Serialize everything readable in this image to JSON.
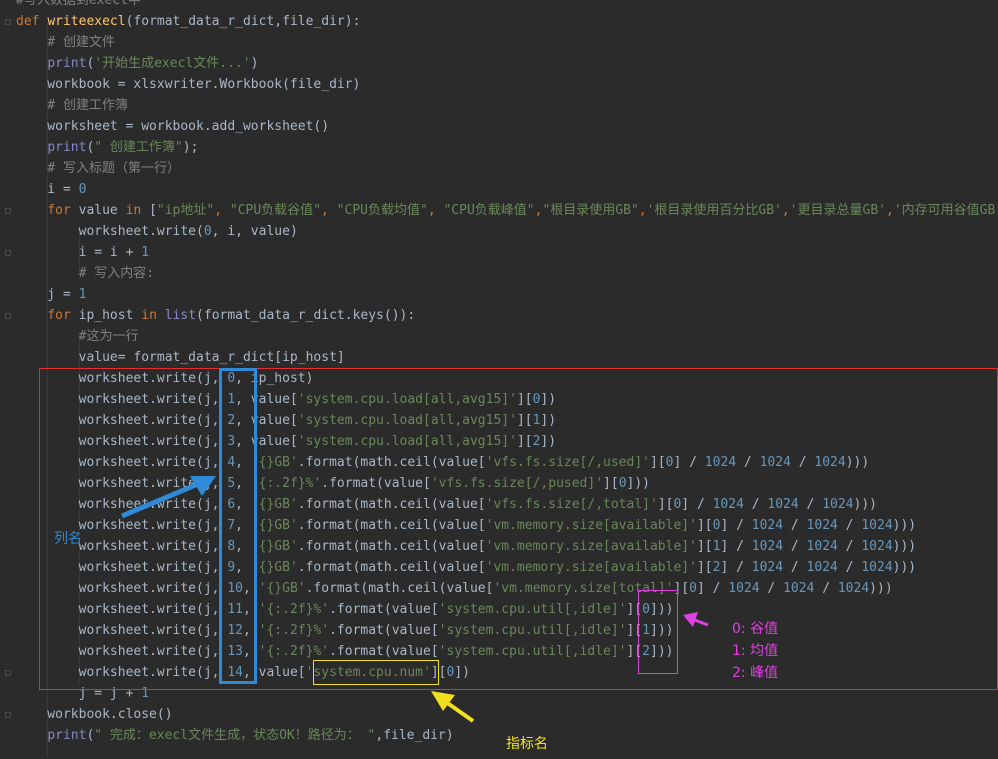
{
  "editor": {
    "language": "python",
    "lines": [
      {
        "tokens": [
          {
            "t": "#写入数据到execl中",
            "c": "cmt"
          }
        ]
      },
      {
        "tokens": [
          {
            "t": "def ",
            "c": "kw"
          },
          {
            "t": "writeexecl",
            "c": "fn"
          },
          {
            "t": "(format_data_r_dict,file_dir):",
            "c": "p"
          }
        ]
      },
      {
        "tokens": [
          {
            "t": "    # 创建文件",
            "c": "cmt"
          }
        ]
      },
      {
        "tokens": [
          {
            "t": "    ",
            "c": "p"
          },
          {
            "t": "print",
            "c": "bi"
          },
          {
            "t": "(",
            "c": "p"
          },
          {
            "t": "'开始生成execl文件...'",
            "c": "str"
          },
          {
            "t": ")",
            "c": "p"
          }
        ]
      },
      {
        "tokens": [
          {
            "t": "    workbook = xlsxwriter.Workbook(file_dir)",
            "c": "p"
          }
        ]
      },
      {
        "tokens": [
          {
            "t": "    # 创建工作簿",
            "c": "cmt"
          }
        ]
      },
      {
        "tokens": [
          {
            "t": "    worksheet = workbook.add_worksheet()",
            "c": "p"
          }
        ]
      },
      {
        "tokens": [
          {
            "t": "    ",
            "c": "p"
          },
          {
            "t": "print",
            "c": "bi"
          },
          {
            "t": "(",
            "c": "p"
          },
          {
            "t": "\" 创建工作簿\"",
            "c": "str"
          },
          {
            "t": ");",
            "c": "p"
          }
        ]
      },
      {
        "tokens": [
          {
            "t": "    # 写入标题（第一行）",
            "c": "cmt"
          }
        ]
      },
      {
        "tokens": [
          {
            "t": "    i = ",
            "c": "p"
          },
          {
            "t": "0",
            "c": "num"
          }
        ]
      },
      {
        "tokens": [
          {
            "t": "    ",
            "c": "p"
          },
          {
            "t": "for ",
            "c": "kw"
          },
          {
            "t": "value ",
            "c": "p"
          },
          {
            "t": "in ",
            "c": "kw"
          },
          {
            "t": "[",
            "c": "p"
          },
          {
            "t": "\"ip地址\"",
            "c": "str"
          },
          {
            "t": ", ",
            "c": "kw"
          },
          {
            "t": "\"CPU负载谷值\"",
            "c": "str"
          },
          {
            "t": ", ",
            "c": "kw"
          },
          {
            "t": "\"CPU负载均值\"",
            "c": "str"
          },
          {
            "t": ", ",
            "c": "kw"
          },
          {
            "t": "\"CPU负载峰值\"",
            "c": "str"
          },
          {
            "t": ",",
            "c": "kw"
          },
          {
            "t": "\"根目录使用GB\"",
            "c": "str"
          },
          {
            "t": ",",
            "c": "kw"
          },
          {
            "t": "'根目录使用百分比GB'",
            "c": "str"
          },
          {
            "t": ",",
            "c": "kw"
          },
          {
            "t": "'更目录总量GB'",
            "c": "str"
          },
          {
            "t": ",",
            "c": "kw"
          },
          {
            "t": "'内存可用谷值GB'",
            "c": "str"
          }
        ]
      },
      {
        "tokens": [
          {
            "t": "        worksheet.write(",
            "c": "p"
          },
          {
            "t": "0",
            "c": "num"
          },
          {
            "t": ", i, value)",
            "c": "p"
          }
        ]
      },
      {
        "tokens": [
          {
            "t": "        i = i + ",
            "c": "p"
          },
          {
            "t": "1",
            "c": "num"
          }
        ]
      },
      {
        "tokens": [
          {
            "t": "        # 写入内容:",
            "c": "cmt"
          }
        ]
      },
      {
        "tokens": [
          {
            "t": "    j = ",
            "c": "p"
          },
          {
            "t": "1",
            "c": "num"
          }
        ]
      },
      {
        "tokens": [
          {
            "t": "    ",
            "c": "p"
          },
          {
            "t": "for ",
            "c": "kw"
          },
          {
            "t": "ip_host ",
            "c": "p"
          },
          {
            "t": "in ",
            "c": "kw"
          },
          {
            "t": "list",
            "c": "bi"
          },
          {
            "t": "(format_data_r_dict.keys()):",
            "c": "p"
          }
        ]
      },
      {
        "tokens": [
          {
            "t": "        #这为一行",
            "c": "cmt"
          }
        ]
      },
      {
        "tokens": [
          {
            "t": "        value= format_data_r_dict[ip_host]",
            "c": "p"
          }
        ]
      },
      {
        "tokens": [
          {
            "t": "        worksheet.write(j, ",
            "c": "p"
          },
          {
            "t": "0",
            "c": "num"
          },
          {
            "t": ", ip_host)",
            "c": "p"
          }
        ]
      },
      {
        "tokens": [
          {
            "t": "        worksheet.write(j, ",
            "c": "p"
          },
          {
            "t": "1",
            "c": "num"
          },
          {
            "t": ", value[",
            "c": "p"
          },
          {
            "t": "'system.cpu.load[all,avg15]'",
            "c": "str"
          },
          {
            "t": "][",
            "c": "p"
          },
          {
            "t": "0",
            "c": "num"
          },
          {
            "t": "])",
            "c": "p"
          }
        ]
      },
      {
        "tokens": [
          {
            "t": "        worksheet.write(j, ",
            "c": "p"
          },
          {
            "t": "2",
            "c": "num"
          },
          {
            "t": ", value[",
            "c": "p"
          },
          {
            "t": "'system.cpu.load[all,avg15]'",
            "c": "str"
          },
          {
            "t": "][",
            "c": "p"
          },
          {
            "t": "1",
            "c": "num"
          },
          {
            "t": "])",
            "c": "p"
          }
        ]
      },
      {
        "tokens": [
          {
            "t": "        worksheet.write(j, ",
            "c": "p"
          },
          {
            "t": "3",
            "c": "num"
          },
          {
            "t": ", value[",
            "c": "p"
          },
          {
            "t": "'system.cpu.load[all,avg15]'",
            "c": "str"
          },
          {
            "t": "][",
            "c": "p"
          },
          {
            "t": "2",
            "c": "num"
          },
          {
            "t": "])",
            "c": "p"
          }
        ]
      },
      {
        "tokens": [
          {
            "t": "        worksheet.write(j, ",
            "c": "p"
          },
          {
            "t": "4",
            "c": "num"
          },
          {
            "t": ", ",
            "c": "p"
          },
          {
            "t": "'{}GB'",
            "c": "str"
          },
          {
            "t": ".format(math.ceil(value[",
            "c": "p"
          },
          {
            "t": "'vfs.fs.size[/,used]'",
            "c": "str"
          },
          {
            "t": "][",
            "c": "p"
          },
          {
            "t": "0",
            "c": "num"
          },
          {
            "t": "] / ",
            "c": "p"
          },
          {
            "t": "1024",
            "c": "num"
          },
          {
            "t": " / ",
            "c": "p"
          },
          {
            "t": "1024",
            "c": "num"
          },
          {
            "t": " / ",
            "c": "p"
          },
          {
            "t": "1024",
            "c": "num"
          },
          {
            "t": ")))",
            "c": "p"
          }
        ]
      },
      {
        "tokens": [
          {
            "t": "        worksheet.write(j, ",
            "c": "p"
          },
          {
            "t": "5",
            "c": "num"
          },
          {
            "t": ", ",
            "c": "p"
          },
          {
            "t": "'{:.2f}%'",
            "c": "str"
          },
          {
            "t": ".format(value[",
            "c": "p"
          },
          {
            "t": "'vfs.fs.size[/,pused]'",
            "c": "str"
          },
          {
            "t": "][",
            "c": "p"
          },
          {
            "t": "0",
            "c": "num"
          },
          {
            "t": "]))",
            "c": "p"
          }
        ]
      },
      {
        "tokens": [
          {
            "t": "        worksheet.write(j, ",
            "c": "p"
          },
          {
            "t": "6",
            "c": "num"
          },
          {
            "t": ", ",
            "c": "p"
          },
          {
            "t": "'{}GB'",
            "c": "str"
          },
          {
            "t": ".format(math.ceil(value[",
            "c": "p"
          },
          {
            "t": "'vfs.fs.size[/,total]'",
            "c": "str"
          },
          {
            "t": "][",
            "c": "p"
          },
          {
            "t": "0",
            "c": "num"
          },
          {
            "t": "] / ",
            "c": "p"
          },
          {
            "t": "1024",
            "c": "num"
          },
          {
            "t": " / ",
            "c": "p"
          },
          {
            "t": "1024",
            "c": "num"
          },
          {
            "t": " / ",
            "c": "p"
          },
          {
            "t": "1024",
            "c": "num"
          },
          {
            "t": ")))",
            "c": "p"
          }
        ]
      },
      {
        "tokens": [
          {
            "t": "        worksheet.write(j, ",
            "c": "p"
          },
          {
            "t": "7",
            "c": "num"
          },
          {
            "t": ", ",
            "c": "p"
          },
          {
            "t": "'{}GB'",
            "c": "str"
          },
          {
            "t": ".format(math.ceil(value[",
            "c": "p"
          },
          {
            "t": "'vm.memory.size[available]'",
            "c": "str"
          },
          {
            "t": "][",
            "c": "p"
          },
          {
            "t": "0",
            "c": "num"
          },
          {
            "t": "] / ",
            "c": "p"
          },
          {
            "t": "1024",
            "c": "num"
          },
          {
            "t": " / ",
            "c": "p"
          },
          {
            "t": "1024",
            "c": "num"
          },
          {
            "t": " / ",
            "c": "p"
          },
          {
            "t": "1024",
            "c": "num"
          },
          {
            "t": ")))",
            "c": "p"
          }
        ]
      },
      {
        "tokens": [
          {
            "t": "        worksheet.write(j, ",
            "c": "p"
          },
          {
            "t": "8",
            "c": "num"
          },
          {
            "t": ", ",
            "c": "p"
          },
          {
            "t": "'{}GB'",
            "c": "str"
          },
          {
            "t": ".format(math.ceil(value[",
            "c": "p"
          },
          {
            "t": "'vm.memory.size[available]'",
            "c": "str"
          },
          {
            "t": "][",
            "c": "p"
          },
          {
            "t": "1",
            "c": "num"
          },
          {
            "t": "] / ",
            "c": "p"
          },
          {
            "t": "1024",
            "c": "num"
          },
          {
            "t": " / ",
            "c": "p"
          },
          {
            "t": "1024",
            "c": "num"
          },
          {
            "t": " / ",
            "c": "p"
          },
          {
            "t": "1024",
            "c": "num"
          },
          {
            "t": ")))",
            "c": "p"
          }
        ]
      },
      {
        "tokens": [
          {
            "t": "        worksheet.write(j, ",
            "c": "p"
          },
          {
            "t": "9",
            "c": "num"
          },
          {
            "t": ", ",
            "c": "p"
          },
          {
            "t": "'{}GB'",
            "c": "str"
          },
          {
            "t": ".format(math.ceil(value[",
            "c": "p"
          },
          {
            "t": "'vm.memory.size[available]'",
            "c": "str"
          },
          {
            "t": "][",
            "c": "p"
          },
          {
            "t": "2",
            "c": "num"
          },
          {
            "t": "] / ",
            "c": "p"
          },
          {
            "t": "1024",
            "c": "num"
          },
          {
            "t": " / ",
            "c": "p"
          },
          {
            "t": "1024",
            "c": "num"
          },
          {
            "t": " / ",
            "c": "p"
          },
          {
            "t": "1024",
            "c": "num"
          },
          {
            "t": ")))",
            "c": "p"
          }
        ]
      },
      {
        "tokens": [
          {
            "t": "        worksheet.write(j, ",
            "c": "p"
          },
          {
            "t": "10",
            "c": "num"
          },
          {
            "t": ", ",
            "c": "p"
          },
          {
            "t": "'{}GB'",
            "c": "str"
          },
          {
            "t": ".format(math.ceil(value[",
            "c": "p"
          },
          {
            "t": "'vm.memory.size[total]'",
            "c": "str"
          },
          {
            "t": "][",
            "c": "p"
          },
          {
            "t": "0",
            "c": "num"
          },
          {
            "t": "] / ",
            "c": "p"
          },
          {
            "t": "1024",
            "c": "num"
          },
          {
            "t": " / ",
            "c": "p"
          },
          {
            "t": "1024",
            "c": "num"
          },
          {
            "t": " / ",
            "c": "p"
          },
          {
            "t": "1024",
            "c": "num"
          },
          {
            "t": ")))",
            "c": "p"
          }
        ]
      },
      {
        "tokens": [
          {
            "t": "        worksheet.write(j, ",
            "c": "p"
          },
          {
            "t": "11",
            "c": "num"
          },
          {
            "t": ", ",
            "c": "p"
          },
          {
            "t": "'{:.2f}%'",
            "c": "str"
          },
          {
            "t": ".format(value[",
            "c": "p"
          },
          {
            "t": "'system.cpu.util[,idle]'",
            "c": "str"
          },
          {
            "t": "][",
            "c": "p"
          },
          {
            "t": "0",
            "c": "num"
          },
          {
            "t": "]))",
            "c": "p"
          }
        ]
      },
      {
        "tokens": [
          {
            "t": "        worksheet.write(j, ",
            "c": "p"
          },
          {
            "t": "12",
            "c": "num"
          },
          {
            "t": ", ",
            "c": "p"
          },
          {
            "t": "'{:.2f}%'",
            "c": "str"
          },
          {
            "t": ".format(value[",
            "c": "p"
          },
          {
            "t": "'system.cpu.util[,idle]'",
            "c": "str"
          },
          {
            "t": "][",
            "c": "p"
          },
          {
            "t": "1",
            "c": "num"
          },
          {
            "t": "]))",
            "c": "p"
          }
        ]
      },
      {
        "tokens": [
          {
            "t": "        worksheet.write(j, ",
            "c": "p"
          },
          {
            "t": "13",
            "c": "num"
          },
          {
            "t": ", ",
            "c": "p"
          },
          {
            "t": "'{:.2f}%'",
            "c": "str"
          },
          {
            "t": ".format(value[",
            "c": "p"
          },
          {
            "t": "'system.cpu.util[,idle]'",
            "c": "str"
          },
          {
            "t": "][",
            "c": "p"
          },
          {
            "t": "2",
            "c": "num"
          },
          {
            "t": "]))",
            "c": "p"
          }
        ]
      },
      {
        "tokens": [
          {
            "t": "        worksheet.write(j, ",
            "c": "p"
          },
          {
            "t": "14",
            "c": "num"
          },
          {
            "t": ", value[",
            "c": "p"
          },
          {
            "t": "'system.cpu.num'",
            "c": "str"
          },
          {
            "t": "][",
            "c": "p"
          },
          {
            "t": "0",
            "c": "num"
          },
          {
            "t": "])",
            "c": "p"
          }
        ]
      },
      {
        "tokens": [
          {
            "t": "        j = j + ",
            "c": "p"
          },
          {
            "t": "1",
            "c": "num"
          }
        ]
      },
      {
        "tokens": [
          {
            "t": "    workbook.close()",
            "c": "p"
          }
        ]
      },
      {
        "tokens": [
          {
            "t": "    ",
            "c": "p"
          },
          {
            "t": "print",
            "c": "bi"
          },
          {
            "t": "(",
            "c": "p"
          },
          {
            "t": "\" 完成：execl文件生成，状态OK！路径为： \"",
            "c": "str"
          },
          {
            "t": ",file_dir)",
            "c": "p"
          }
        ]
      }
    ]
  },
  "annotations": {
    "column_label": "列名",
    "index_legend": [
      "0: 谷值",
      "1: 均值",
      "2: 峰值"
    ],
    "metric_label": "指标名"
  },
  "colors": {
    "background": "#2b2b2b",
    "keyword": "#cc7832",
    "string": "#6a8759",
    "number": "#6897bb",
    "comment": "#808080",
    "function": "#ffc66d",
    "builtin": "#8888c6",
    "plain": "#a9b7c6",
    "red_box": "#e03030",
    "blue_box": "#2f8ad8",
    "magenta": "#e040e0",
    "yellow": "#f0e020"
  },
  "icons": [
    "fold-icon",
    "arrow-icon"
  ]
}
